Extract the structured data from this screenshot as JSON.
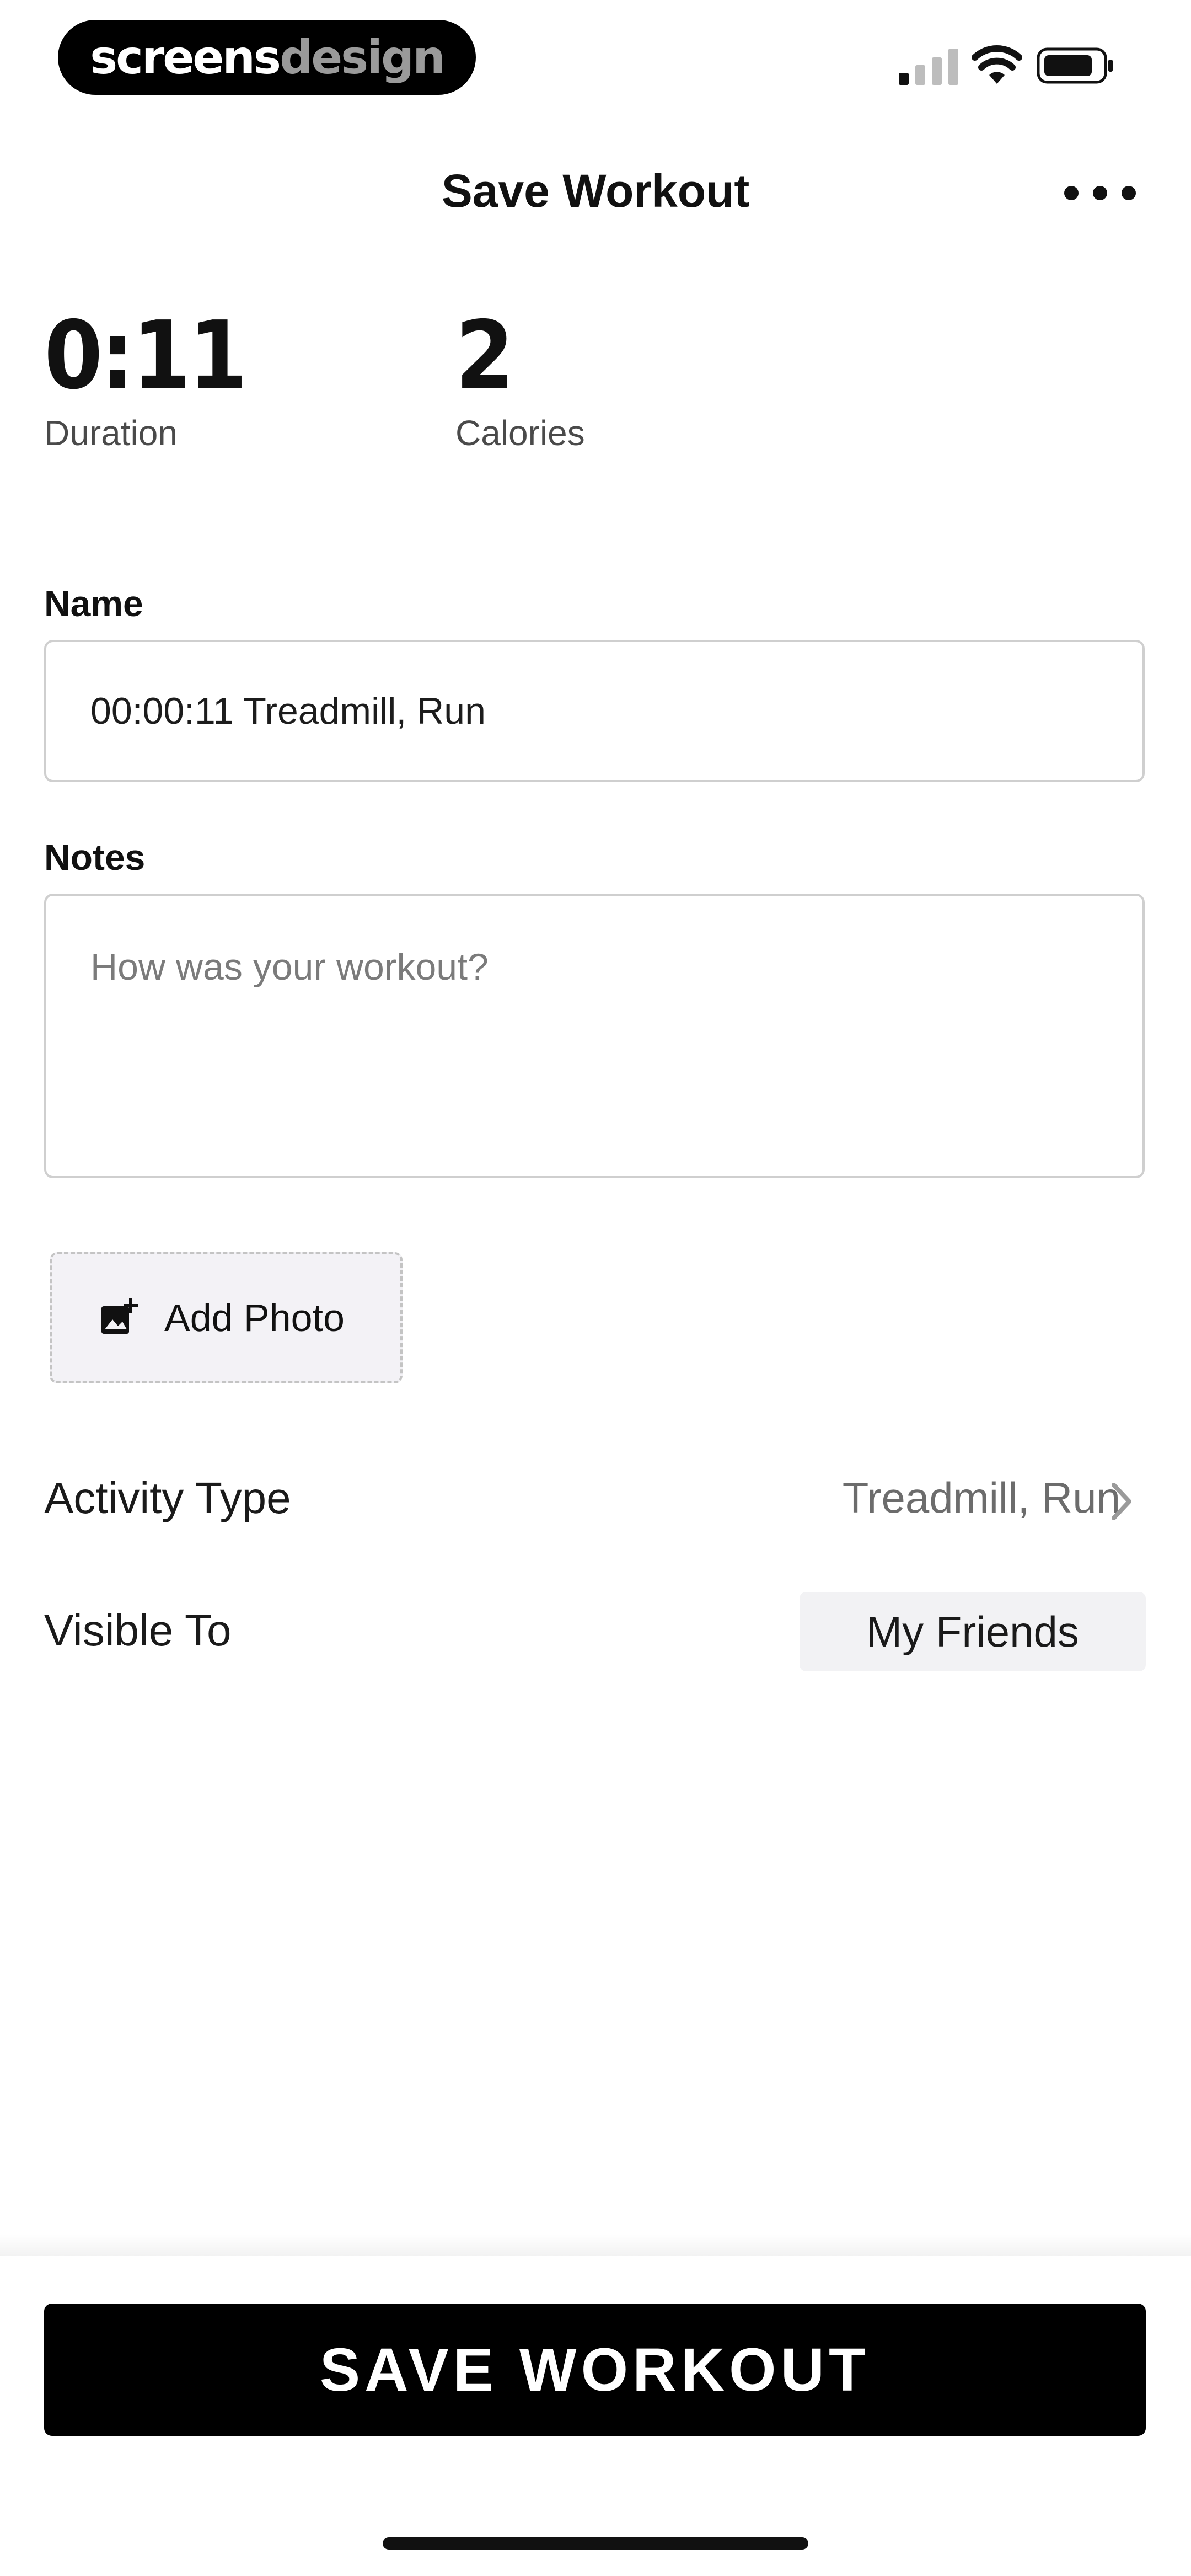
{
  "status_bar": {
    "brand_part1": "screens",
    "brand_part2": "design"
  },
  "header": {
    "title": "Save Workout"
  },
  "stats": {
    "duration": {
      "value": "0:11",
      "label": "Duration"
    },
    "calories": {
      "value": "2",
      "label": "Calories"
    }
  },
  "form": {
    "name_label": "Name",
    "name_value": "00:00:11 Treadmill, Run",
    "notes_label": "Notes",
    "notes_placeholder": "How was your workout?"
  },
  "add_photo": {
    "label": "Add Photo"
  },
  "activity": {
    "label": "Activity Type",
    "value": "Treadmill, Run"
  },
  "visibility": {
    "label": "Visible To",
    "value": "My Friends"
  },
  "footer": {
    "save_label": "SAVE WORKOUT"
  }
}
